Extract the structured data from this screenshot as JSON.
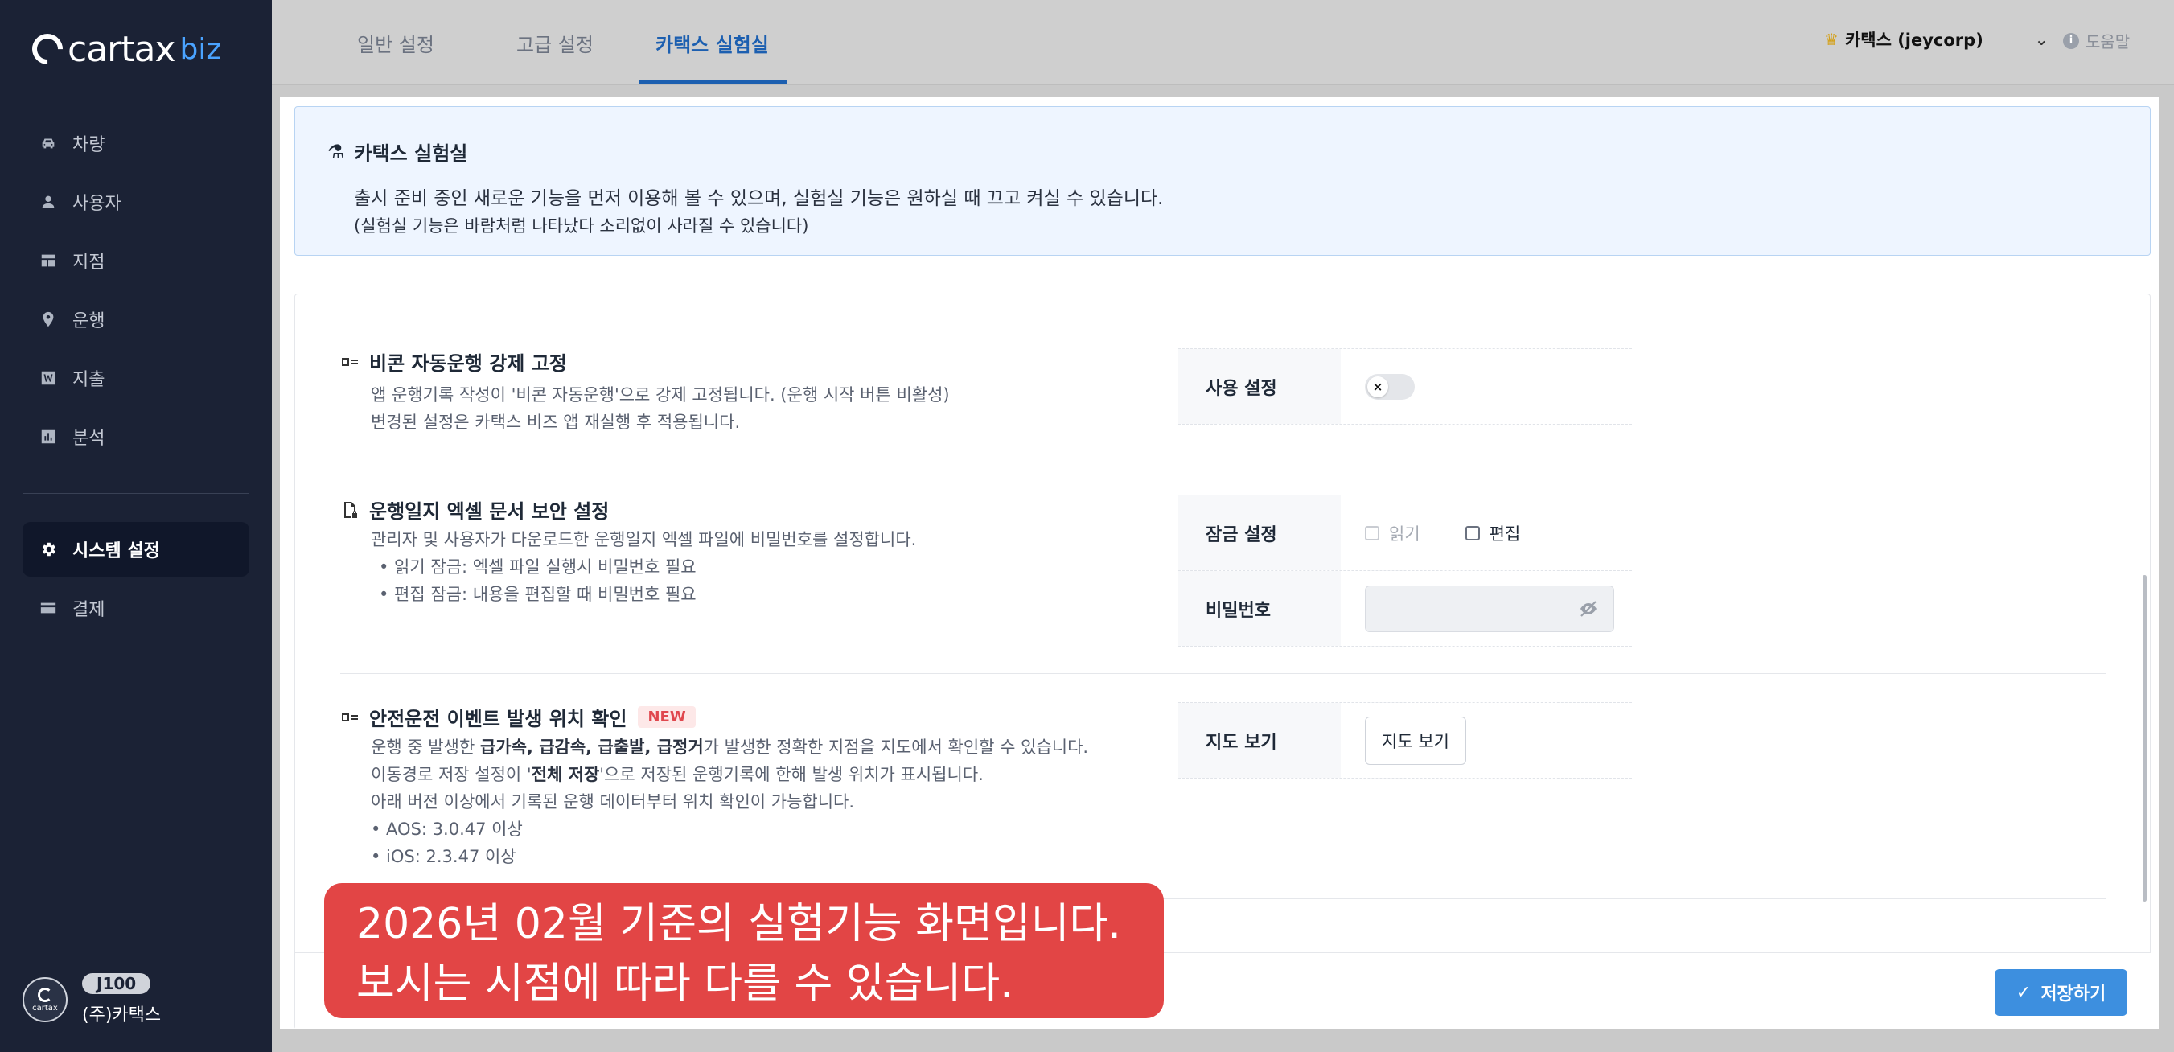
{
  "brand": {
    "name": "cartax",
    "suffix": "biz"
  },
  "sidebar": {
    "items": [
      {
        "label": "차량",
        "icon": "car-icon"
      },
      {
        "label": "사용자",
        "icon": "person-icon"
      },
      {
        "label": "지점",
        "icon": "branch-icon"
      },
      {
        "label": "운행",
        "icon": "location-pin-icon"
      },
      {
        "label": "지출",
        "icon": "expense-icon"
      },
      {
        "label": "분석",
        "icon": "chart-icon"
      }
    ],
    "items2": [
      {
        "label": "시스템 설정",
        "icon": "gear-icon",
        "active": true
      },
      {
        "label": "결제",
        "icon": "card-icon"
      }
    ],
    "user": {
      "badge": "J100",
      "name": "(주)카택스",
      "avatar_text": "cartax"
    }
  },
  "tabs": [
    {
      "label": "일반 설정"
    },
    {
      "label": "고급 설정"
    },
    {
      "label": "카택스 실험실",
      "active": true
    }
  ],
  "account": {
    "label": "카택스 (jeycorp)"
  },
  "help": {
    "label": "도움말"
  },
  "lab": {
    "title": "카택스 실험실",
    "line1": "출시 준비 중인 새로운 기능을 먼저 이용해 볼 수 있으며, 실험실 기능은 원하실 때 끄고 켜실 수 있습니다.",
    "line2": "(실험실 기능은 바람처럼 나타났다 소리없이 사라질 수 있습니다)"
  },
  "features": {
    "beacon": {
      "title": "비콘 자동운행 강제 고정",
      "desc1": "앱 운행기록 작성이 '비콘 자동운행'으로 강제 고정됩니다. (운행 시작 버튼 비활성)",
      "desc2": "변경된 설정은 카택스 비즈 앱 재실행 후 적용됩니다.",
      "key": "사용 설정"
    },
    "excel": {
      "title": "운행일지 엑셀 문서 보안 설정",
      "desc1": "관리자 및 사용자가 다운로드한 운행일지 엑셀 파일에 비밀번호를 설정합니다.",
      "desc2": "• 읽기 잠금: 엑셀 파일 실행시 비밀번호 필요",
      "desc3": "• 편집 잠금: 내용을 편집할 때 비밀번호 필요",
      "lock_key": "잠금 설정",
      "read_label": "읽기",
      "edit_label": "편집",
      "pw_key": "비밀번호"
    },
    "safety": {
      "title": "안전운전 이벤트 발생 위치 확인",
      "badge": "NEW",
      "d1_pre": "운행 중 발생한 ",
      "d1_bold": "급가속, 급감속, 급출발, 급정거",
      "d1_post": "가 발생한 정확한 지점을 지도에서 확인할 수 있습니다.",
      "d2_pre": "이동경로 저장 설정이 '",
      "d2_bold": "전체 저장",
      "d2_post": "'으로 저장된 운행기록에 한해 발생 위치가 표시됩니다.",
      "d3": "아래 버전 이상에서 기록된 운행 데이터부터 위치 확인이 가능합니다.",
      "d4": "• AOS: 3.0.47 이상",
      "d5": "• iOS: 2.3.47 이상",
      "key": "지도 보기",
      "button": "지도 보기"
    }
  },
  "save": {
    "label": "저장하기"
  },
  "notice": {
    "line1": "2026년 02월 기준의 실험기능 화면입니다.",
    "line2": "보시는 시점에 따라 다를 수 있습니다."
  },
  "colors": {
    "sidebar": "#1b2235",
    "accent": "#1c5fb0",
    "save": "#3d8fdf",
    "notice": "#e24545"
  }
}
